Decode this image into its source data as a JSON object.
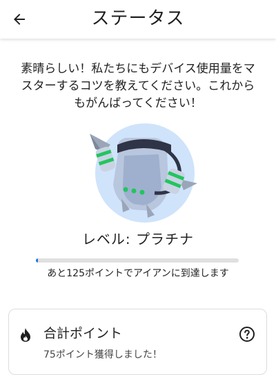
{
  "header": {
    "back_icon": "arrow-left-icon",
    "title": "ステータス"
  },
  "message": {
    "line1": "素晴らしい！私たちにもデバイス使用量をマ",
    "line2": "スターするコツを教えてください。これから",
    "line3": "もがんばってください！"
  },
  "badge": {
    "icon": "jetpack-badge-icon",
    "circle_color": "#cfe3fb",
    "led_color": "#22c55e"
  },
  "level": {
    "label": "レベル: プラチナ",
    "progress_fraction": 0.01,
    "progress_text": "あと125ポイントでアイアンに到達します",
    "accent_color": "#1a73e8"
  },
  "points_card": {
    "icon": "flame-icon",
    "title": "合計ポイント",
    "subtitle": "75ポイント獲得しました！",
    "help_icon": "help-circle-icon"
  }
}
